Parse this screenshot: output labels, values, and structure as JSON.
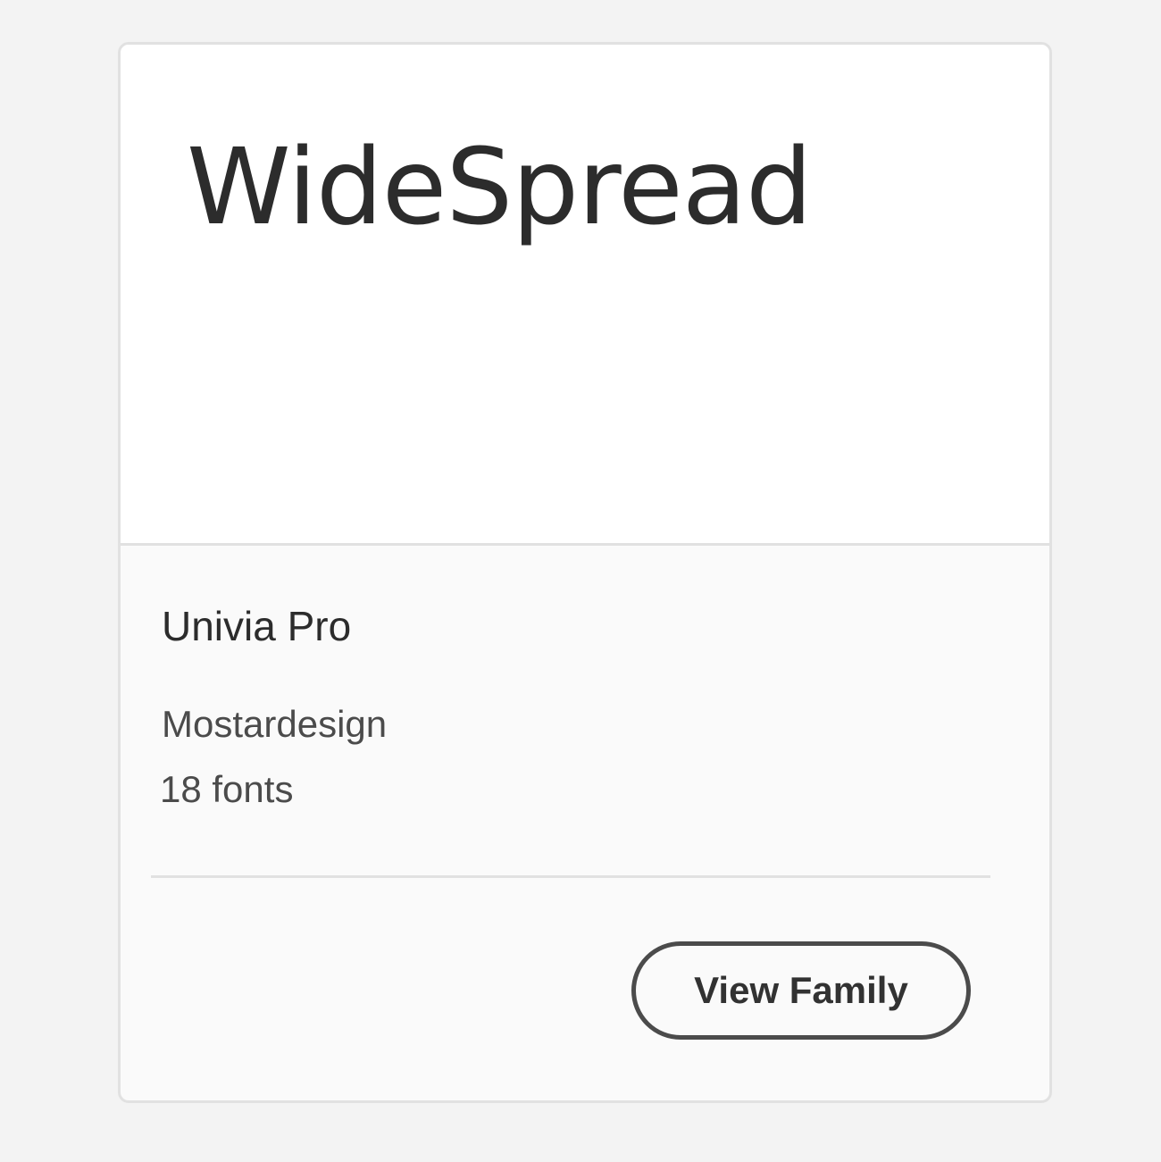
{
  "card": {
    "preview_text": "WideSpread",
    "family_name": "Univia Pro",
    "foundry": "Mostardesign",
    "font_count": "18 fonts",
    "view_family_label": "View Family"
  },
  "colors": {
    "page_background": "#f3f3f3",
    "card_background": "#fafafa",
    "preview_background": "#ffffff",
    "border": "#e1e1e1",
    "text_primary": "#2c2c2c",
    "text_secondary": "#4b4b4b",
    "button_border": "#4b4b4b"
  }
}
